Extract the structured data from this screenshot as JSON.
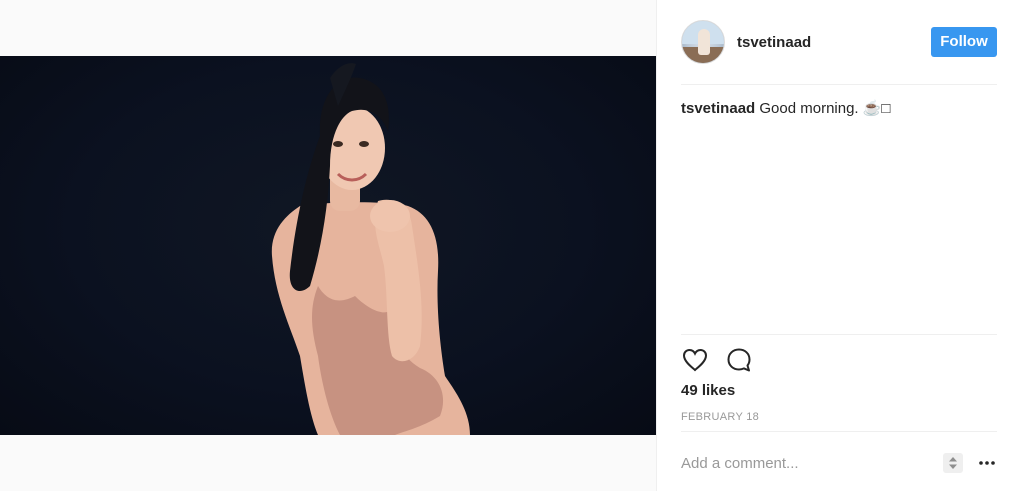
{
  "post": {
    "username": "tsvetinaad",
    "follow_label": "Follow",
    "caption_user": "tsvetinaad",
    "caption_text": " Good morning. ☕□",
    "likes": "49 likes",
    "date": "FEBRUARY 18",
    "comment_placeholder": "Add a comment..."
  },
  "icons": {
    "like": "heart-icon",
    "comment": "comment-bubble-icon",
    "sort": "up-down-arrows-icon",
    "more": "ellipsis-icon"
  },
  "colors": {
    "follow_button": "#3897f0",
    "photo_background": "#0b1120",
    "muted_text": "#999999"
  }
}
